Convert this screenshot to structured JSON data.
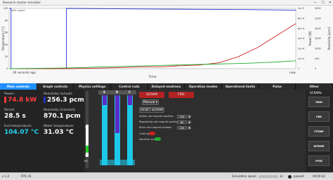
{
  "window": {
    "title": "Research reactor simulator",
    "controls": [
      "—",
      "☐",
      "✕"
    ]
  },
  "graph": {
    "chart_data": {
      "type": "line",
      "x_left_label": "30 seconds ago",
      "x_right_label": "now",
      "xlabel": "Time",
      "left_axis": {
        "label": "Temperature [°C]",
        "ticks": [
          "0",
          "20",
          "40",
          "60",
          "80",
          "100"
        ]
      },
      "power_axis": {
        "label": "Power [W]",
        "ticks": [
          "1",
          "1e+4",
          "2e+4",
          "4e+4",
          "6e+4",
          "8e+4",
          "1e+5"
        ]
      },
      "reactivity_axis": {
        "label": "Reactivity [pcm]",
        "ticks": [
          "0",
          "500",
          "1000",
          "1500",
          "2000",
          "2500",
          "3000"
        ]
      },
      "legend_tag": "Main graph",
      "series": [
        {
          "color": "#2233cc",
          "x": [
            0,
            0.2,
            0.2,
            5.8,
            6,
            6,
            10,
            15,
            20,
            25,
            28,
            30
          ],
          "y": [
            100,
            100,
            0,
            0,
            0,
            100,
            99.5,
            99,
            98.5,
            98,
            97.5,
            97
          ]
        },
        {
          "color": "#cc2222",
          "x": [
            0,
            6,
            10,
            12,
            14,
            16,
            18,
            20,
            22,
            24,
            26,
            28,
            30
          ],
          "y": [
            0,
            0,
            1,
            2,
            3,
            3,
            5,
            6,
            10,
            20,
            35,
            55,
            74.8
          ]
        },
        {
          "color": "#22aa33",
          "x": [
            0,
            6,
            10,
            15,
            20,
            25,
            28,
            30
          ],
          "y": [
            0,
            1,
            3,
            5,
            7,
            9,
            11,
            13
          ]
        }
      ]
    }
  },
  "tabs": [
    {
      "label": "Main controls",
      "active": true
    },
    {
      "label": "Graph controls",
      "active": false
    },
    {
      "label": "Physics settings",
      "active": false
    },
    {
      "label": "Control rods",
      "active": false
    },
    {
      "label": "Delayed neutrons",
      "active": false
    },
    {
      "label": "Operation modes",
      "active": false
    },
    {
      "label": "Operational limits",
      "active": false
    },
    {
      "label": "Pulse",
      "active": false
    },
    {
      "label": "Other",
      "active": false
    }
  ],
  "readouts": {
    "power": {
      "label": "Power:",
      "value": "74.8 kW"
    },
    "reactivity_actual": {
      "label": "Reactivity (actual):",
      "value": "256.3 pcm"
    },
    "period": {
      "label": "Period:",
      "value": "28.5 s"
    },
    "reactivity_inserted": {
      "label": "Reactivity (inserted):",
      "value": "870.1 pcm"
    },
    "fuel_temp": {
      "label": "Fuel temperature:",
      "value": "104.07 °C"
    },
    "water_temp": {
      "label": "Water temperature:",
      "value": "31.03 °C"
    }
  },
  "rods": {
    "labels": [
      "S",
      "R",
      "C"
    ],
    "scale_labels": [
      "20",
      "0",
      "Ed"
    ],
    "rod_levels": [
      0.95,
      0.6,
      0.95
    ]
  },
  "buttons": {
    "scram": "SCRAM",
    "fire": "FIRE",
    "mode": "Manual",
    "reset_scram": "RESET SCRAM"
  },
  "magnet_rows": [
    {
      "label": "Safety rod magnet position",
      "value": "100"
    },
    {
      "label": "Regulating rod magnet position",
      "value": "60"
    },
    {
      "label": "Shim rod magnet position",
      "value": "100"
    }
  ],
  "toggles": [
    {
      "label": "Cooling",
      "state": "off"
    },
    {
      "label": "Neutron source",
      "state": "on"
    }
  ],
  "scrams": {
    "title": "SCRAMs",
    "items": [
      "MAN",
      "PER",
      "FTEMP",
      "WTEMP",
      "POW"
    ]
  },
  "status": {
    "version": "v 1.2",
    "fps": "FPS: 41",
    "sim_speed": "Simulation speed",
    "speed_value": "1x",
    "paused": "paused",
    "time": "00:00:42"
  }
}
